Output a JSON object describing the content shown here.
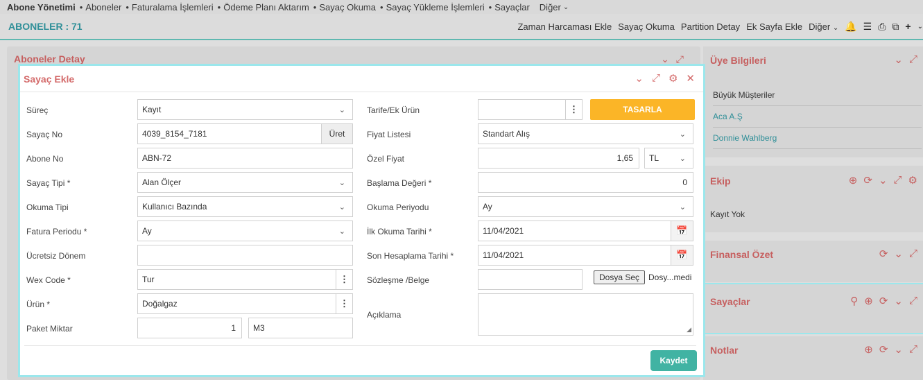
{
  "topnav": {
    "brand": "Abone Yönetimi",
    "items": [
      "Aboneler",
      "Faturalama İşlemleri",
      "Ödeme Planı Aktarım",
      "Sayaç Okuma",
      "Sayaç Yükleme İşlemleri",
      "Sayaçlar"
    ],
    "more": "Diğer"
  },
  "subbar": {
    "title": "ABONELER : 71",
    "actions": [
      "Zaman Harcaması Ekle",
      "Sayaç Okuma",
      "Partition Detay",
      "Ek Sayfa Ekle"
    ],
    "more": "Diğer"
  },
  "background": {
    "panel_title": "Aboneler Detay"
  },
  "right": {
    "uye": {
      "title": "Üye Bilgileri",
      "rows": [
        "Büyük Müşteriler",
        "Aca A.Ş",
        "Donnie Wahlberg"
      ]
    },
    "ekip": {
      "title": "Ekip",
      "empty": "Kayıt Yok"
    },
    "finans": {
      "title": "Finansal Özet"
    },
    "sayaclar": {
      "title": "Sayaçlar"
    },
    "notlar": {
      "title": "Notlar"
    }
  },
  "modal": {
    "title": "Sayaç Ekle",
    "left": {
      "surec": {
        "label": "Süreç",
        "value": "Kayıt"
      },
      "sayac_no": {
        "label": "Sayaç No",
        "value": "4039_8154_7181",
        "button": "Üret"
      },
      "abone_no": {
        "label": "Abone No",
        "value": "ABN-72"
      },
      "sayac_tipi": {
        "label": "Sayaç Tipi *",
        "value": "Alan Ölçer"
      },
      "okuma_tipi": {
        "label": "Okuma Tipi",
        "value": "Kullanıcı Bazında"
      },
      "fatura_periodu": {
        "label": "Fatura Periodu *",
        "value": "Ay"
      },
      "ucretsiz_donem": {
        "label": "Ücretsiz Dönem",
        "value": ""
      },
      "wex_code": {
        "label": "Wex Code *",
        "value": "Tur"
      },
      "urun": {
        "label": "Ürün *",
        "value": "Doğalgaz"
      },
      "paket_miktar": {
        "label": "Paket Miktar",
        "value": "1",
        "unit": "M3"
      }
    },
    "right": {
      "tarife": {
        "label": "Tarife/Ek Ürün",
        "value": "",
        "button": "TASARLA"
      },
      "fiyat_listesi": {
        "label": "Fiyat Listesi",
        "value": "Standart Alış"
      },
      "ozel_fiyat": {
        "label": "Özel Fiyat",
        "value": "1,65",
        "currency": "TL"
      },
      "baslama_degeri": {
        "label": "Başlama Değeri *",
        "value": "0"
      },
      "okuma_periyodu": {
        "label": "Okuma Periyodu",
        "value": "Ay"
      },
      "ilk_okuma": {
        "label": "İlk Okuma Tarihi *",
        "value": "11/04/2021"
      },
      "son_hesaplama": {
        "label": "Son Hesaplama Tarihi *",
        "value": "11/04/2021"
      },
      "sozlesme": {
        "label": "Sözleşme /Belge",
        "file_button": "Dosya Seç",
        "file_name": "Dosy...medi"
      },
      "aciklama": {
        "label": "Açıklama",
        "value": ""
      }
    },
    "save": "Kaydet"
  },
  "colors": {
    "accent": "#2f8f98",
    "header_red": "#d46b6b",
    "warning": "#fbb527",
    "save": "#41b3a3",
    "highlight": "#9be7ec"
  },
  "icons": [
    "chevron-down-icon",
    "expand-icon",
    "gear-icon",
    "close-icon",
    "bell-icon",
    "list-icon",
    "print-icon",
    "copy-icon",
    "plus-icon",
    "plus-circle-icon",
    "refresh-icon",
    "search-icon",
    "calendar-icon",
    "kebab-icon"
  ]
}
